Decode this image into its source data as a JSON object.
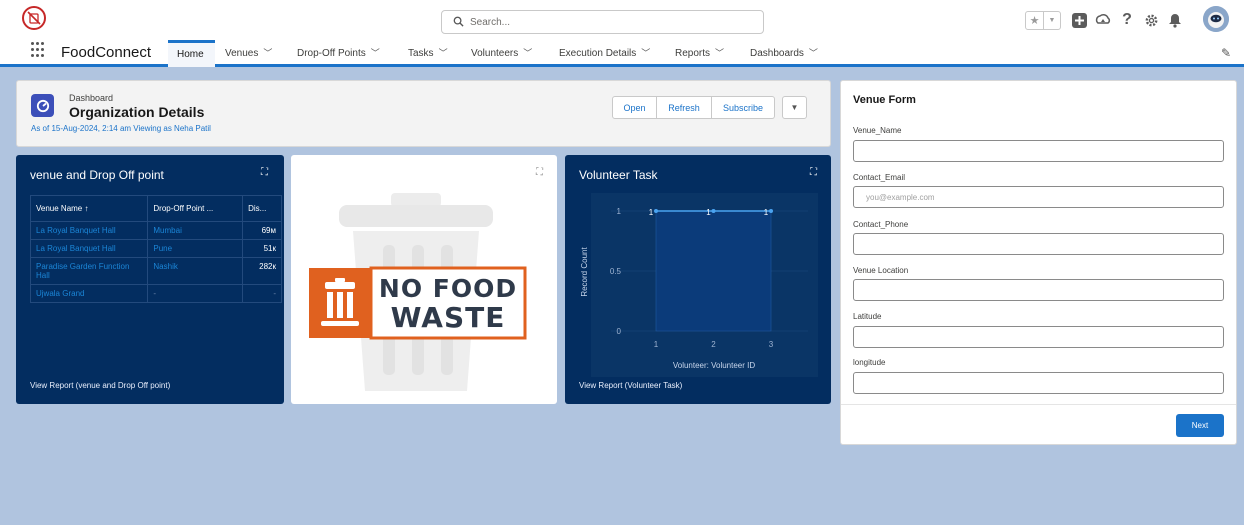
{
  "header": {
    "search_placeholder": "Search...",
    "icons": [
      "favorites-star-icon",
      "favorites-dropdown-icon",
      "add-icon",
      "trailhead-icon",
      "help-icon",
      "setup-gear-icon",
      "notifications-bell-icon",
      "user-avatar"
    ]
  },
  "nav": {
    "app_name": "FoodConnect",
    "items": [
      "Home",
      "Venues",
      "Drop-Off Points",
      "Tasks",
      "Volunteers",
      "Execution Details",
      "Reports",
      "Dashboards"
    ],
    "active": "Home"
  },
  "dashboard": {
    "kicker": "Dashboard",
    "title": "Organization Details",
    "meta": "As of 15-Aug-2024, 2:14 am Viewing as Neha Patil",
    "buttons": {
      "open": "Open",
      "refresh": "Refresh",
      "subscribe": "Subscribe"
    }
  },
  "widgets": {
    "venue_table": {
      "title": "venue and Drop Off point",
      "columns": [
        "Venue Name ↑",
        "Drop-Off Point ...",
        "Dis..."
      ],
      "rows": [
        [
          "La Royal Banquet Hall",
          "Mumbai",
          "69м"
        ],
        [
          "La Royal Banquet Hall",
          "Pune",
          "51к"
        ],
        [
          "Paradise Garden Function Hall",
          "Nashik",
          "282к"
        ],
        [
          "Ujwala Grand",
          "-",
          "-"
        ]
      ],
      "report_link": "View Report (venue and Drop Off point)"
    },
    "image": {
      "line1": "NO FOOD",
      "line2": "WASTE",
      "accent": "#e0611f"
    },
    "volunteer_task": {
      "title": "Volunteer Task",
      "report_link": "View Report (Volunteer Task)"
    }
  },
  "chart_data": {
    "type": "area",
    "title": "Volunteer Task",
    "xlabel": "Volunteer: Volunteer ID",
    "ylabel": "Record Count",
    "x": [
      1,
      2,
      3
    ],
    "values": [
      1,
      1,
      1
    ],
    "point_labels": [
      "1",
      "1",
      "1"
    ],
    "x_ticks": [
      "1",
      "2",
      "3"
    ],
    "y_ticks": [
      "0",
      "0.5",
      "1"
    ],
    "ylim": [
      0,
      1
    ],
    "xlim": [
      1,
      3
    ],
    "grid": true,
    "colors": {
      "fill": "#0b3b7a",
      "line": "#4aa3f0"
    }
  },
  "form": {
    "title": "Venue Form",
    "fields": [
      {
        "label": "Venue_Name",
        "placeholder": ""
      },
      {
        "label": "Contact_Email",
        "placeholder": "you@example.com"
      },
      {
        "label": "Contact_Phone",
        "placeholder": ""
      },
      {
        "label": "Venue Location",
        "placeholder": ""
      },
      {
        "label": "Latitude",
        "placeholder": ""
      },
      {
        "label": "longitude",
        "placeholder": ""
      }
    ],
    "next": "Next"
  },
  "colors": {
    "brand_blue": "#1b73c9",
    "dark_widget": "#032d60",
    "page_background": "#b0c4df"
  }
}
